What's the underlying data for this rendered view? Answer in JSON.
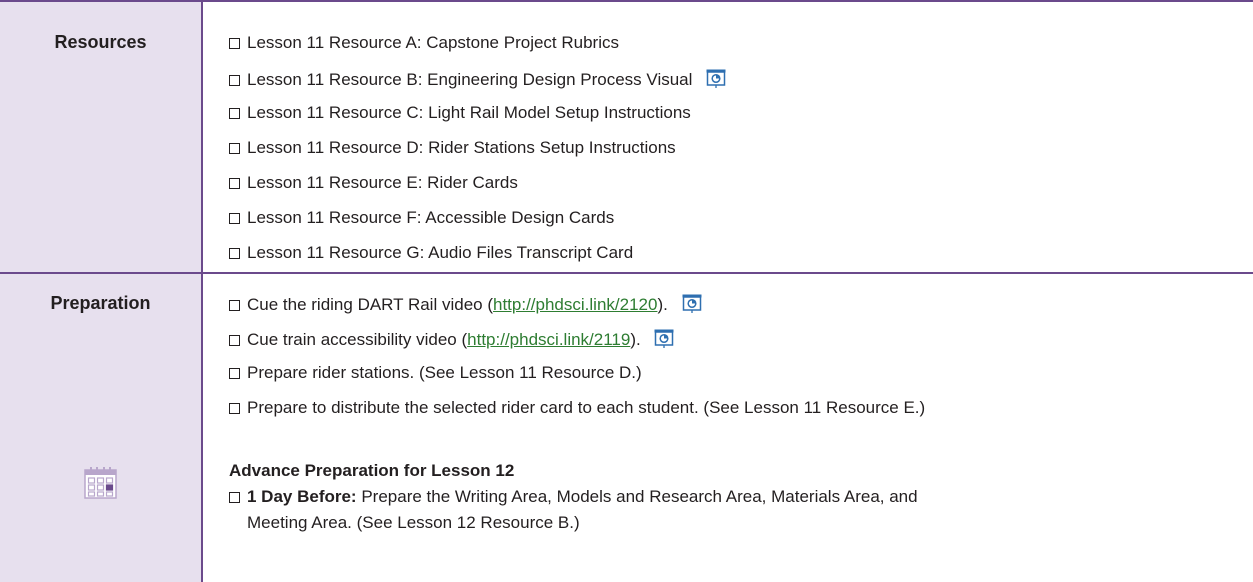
{
  "resources": {
    "label": "Resources",
    "items": [
      {
        "text": "Lesson 11 Resource A: Capstone Project Rubrics",
        "icon": ""
      },
      {
        "text": "Lesson 11 Resource B: Engineering Design Process Visual",
        "icon": "slides-icon"
      },
      {
        "text": "Lesson 11 Resource C: Light Rail Model Setup Instructions",
        "icon": ""
      },
      {
        "text": "Lesson 11 Resource D: Rider Stations Setup Instructions",
        "icon": ""
      },
      {
        "text": "Lesson 11 Resource E: Rider Cards",
        "icon": ""
      },
      {
        "text": "Lesson 11 Resource F: Accessible Design Cards",
        "icon": ""
      },
      {
        "text": "Lesson 11 Resource G: Audio Files Transcript Card",
        "icon": ""
      }
    ]
  },
  "preparation": {
    "label": "Preparation",
    "items": [
      {
        "pre": "Cue the riding DART Rail video (",
        "link": "http://phdsci.link/2120",
        "post": ").",
        "icon": "slides-icon"
      },
      {
        "pre": "Cue train accessibility video (",
        "link": "http://phdsci.link/2119",
        "post": ").",
        "icon": "slides-icon"
      },
      {
        "text": "Prepare rider stations. (See Lesson 11 Resource D.)"
      },
      {
        "text": "Prepare to distribute the selected rider card to each student. (See Lesson 11 Resource E.)"
      }
    ],
    "advance": {
      "heading": "Advance Preparation for Lesson 12",
      "bold_lead": "1 Day Before:",
      "line1": " Prepare the Writing Area, Models and Research Area, Materials Area, and",
      "line2": "Meeting Area. (See Lesson 12 Resource B.)"
    },
    "calendar_icon": "calendar-icon"
  },
  "colors": {
    "rule": "#6b4a8c",
    "label_bg": "#e7e0ee",
    "link": "#2e7d32",
    "icon_blue": "#2e6fb0"
  }
}
